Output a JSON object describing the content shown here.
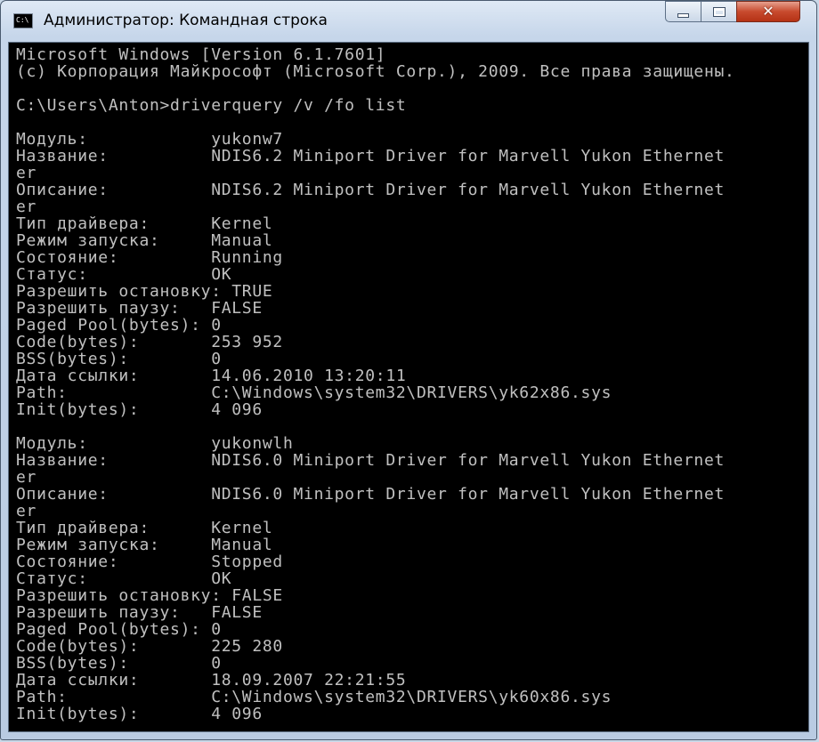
{
  "window": {
    "title": "Администратор: Командная строка",
    "icon": "console-icon",
    "icon_text": "C:\\",
    "controls": [
      "minimize-icon",
      "maximize-icon",
      "close-icon"
    ]
  },
  "console": {
    "lines": [
      "Microsoft Windows [Version 6.1.7601]",
      "(c) Корпорация Майкрософт (Microsoft Corp.), 2009. Все права защищены.",
      "",
      "C:\\Users\\Anton>driverquery /v /fo list",
      "",
      "Модуль:            yukonw7",
      "Название:          NDIS6.2 Miniport Driver for Marvell Yukon Ethernet",
      "er",
      "Описание:          NDIS6.2 Miniport Driver for Marvell Yukon Ethernet",
      "er",
      "Тип драйвера:      Kernel",
      "Режим запуска:     Manual",
      "Состояние:         Running",
      "Статус:            OK",
      "Разрешить остановку: TRUE",
      "Разрешить паузу:   FALSE",
      "Paged Pool(bytes): 0",
      "Code(bytes):       253 952",
      "BSS(bytes):        0",
      "Дата ссылки:       14.06.2010 13:20:11",
      "Path:              C:\\Windows\\system32\\DRIVERS\\yk62x86.sys",
      "Init(bytes):       4 096",
      "",
      "Модуль:            yukonwlh",
      "Название:          NDIS6.0 Miniport Driver for Marvell Yukon Ethernet",
      "er",
      "Описание:          NDIS6.0 Miniport Driver for Marvell Yukon Ethernet",
      "er",
      "Тип драйвера:      Kernel",
      "Режим запуска:     Manual",
      "Состояние:         Stopped",
      "Статус:            OK",
      "Разрешить остановку: FALSE",
      "Разрешить паузу:   FALSE",
      "Paged Pool(bytes): 0",
      "Code(bytes):       225 280",
      "BSS(bytes):        0",
      "Дата ссылки:       18.09.2007 22:21:55",
      "Path:              C:\\Windows\\system32\\DRIVERS\\yk60x86.sys",
      "Init(bytes):       4 096"
    ]
  },
  "colors": {
    "console_bg": "#000000",
    "console_fg": "#c0c0c0",
    "close_button": "#c84a2e"
  }
}
